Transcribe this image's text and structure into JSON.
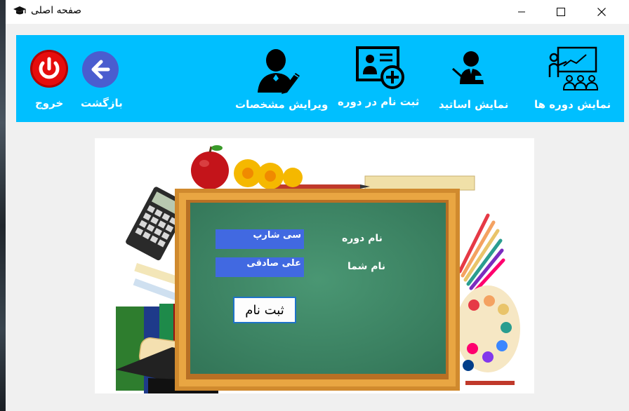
{
  "window": {
    "title": "صفحه اصلی",
    "icon": "graduation-cap-icon",
    "controls": [
      "minimize-icon",
      "maximize-icon",
      "close-icon"
    ]
  },
  "toolbar": {
    "background": "#00bfff",
    "items": [
      {
        "label": "نمایش دوره ها",
        "icon": "classroom-teacher-icon"
      },
      {
        "label": "نمایش اساتید",
        "icon": "teacher-icon"
      },
      {
        "label": "ثبت نام در دوره",
        "icon": "register-course-icon"
      },
      {
        "label": "ویرایش مشخصات",
        "icon": "edit-profile-icon"
      },
      {
        "label": "بازگشت",
        "icon": "back-arrow-icon"
      },
      {
        "label": "خروج",
        "icon": "power-icon"
      }
    ]
  },
  "form": {
    "course_label": "نام دوره",
    "course_value": "سی شارپ",
    "name_label": "نام شما",
    "name_value": "علی صادقی",
    "submit_label": "ثبت نام",
    "field_color": "#4169e1",
    "board_color": "#3e8a68"
  }
}
